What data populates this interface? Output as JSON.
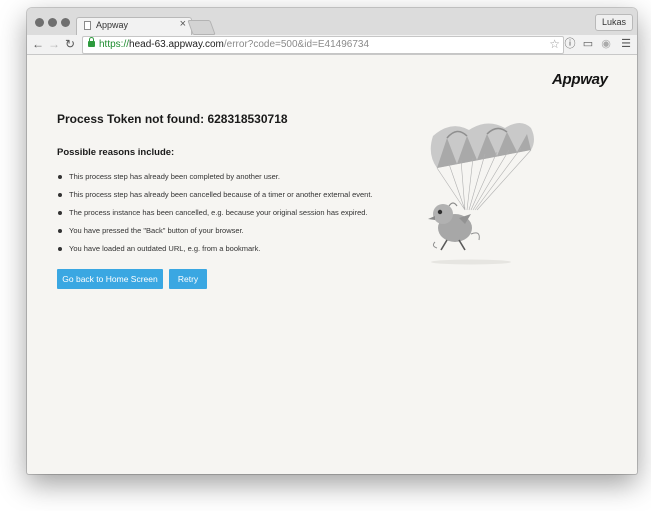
{
  "browser": {
    "tab_title": "Appway",
    "tab_close_glyph": "×",
    "profile_name": "Lukas",
    "url_scheme": "https://",
    "url_host": "head-63.appway.com",
    "url_path": "/error?code=500&id=E41496734"
  },
  "page": {
    "logo": "Appway",
    "heading": "Process Token not found: 628318530718",
    "subheading": "Possible reasons include:",
    "reasons": [
      "This process step has already been completed by another user.",
      "This process step has already been cancelled because of a timer or another external event.",
      "The process instance has been cancelled, e.g. because your original session has expired.",
      "You have pressed the \"Back\" button of your browser.",
      "You have loaded an outdated URL, e.g. from a bookmark."
    ],
    "buttons": {
      "home": "Go back to Home Screen",
      "retry": "Retry"
    }
  },
  "icons": {
    "back": "back-arrow-icon",
    "forward": "forward-arrow-icon",
    "reload": "reload-icon",
    "secure": "lock-icon",
    "bookmark": "star-icon",
    "menu": "hamburger-menu-icon"
  },
  "colors": {
    "page_background": "#f6f5f2",
    "button": "#3aa7e2",
    "secure_url": "#1e8c2f"
  }
}
